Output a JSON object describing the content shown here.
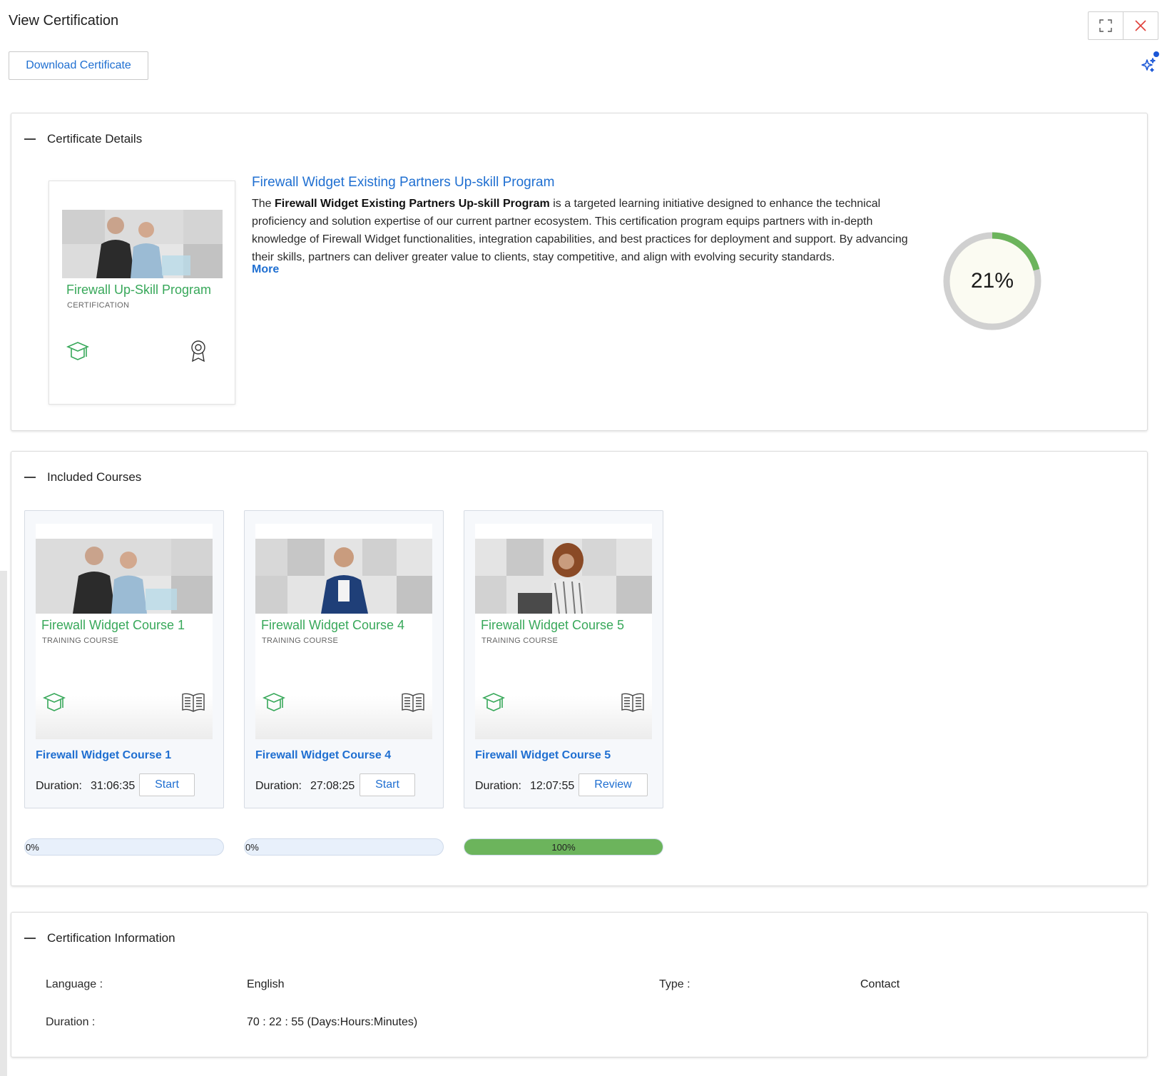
{
  "header": {
    "title": "View Certification"
  },
  "toolbar": {
    "download_label": "Download Certificate"
  },
  "icons": {
    "maximize": "maximize-icon",
    "close": "close-icon",
    "sparkle": "sparkle-icon",
    "mortarboard": "graduation-cap-icon",
    "badge": "award-badge-icon",
    "book": "open-book-icon"
  },
  "colors": {
    "accent_blue": "#1f6fd1",
    "green": "#38a85a",
    "progress_green": "#6cb45c",
    "close_red": "#e0403a"
  },
  "certificate_details": {
    "section_title": "Certificate Details",
    "card": {
      "name": "Firewall Up-Skill Program",
      "type": "CERTIFICATION"
    },
    "title": "Firewall Widget Existing Partners Up-skill Program",
    "desc_prefix": "The ",
    "desc_bold": "Firewall Widget Existing Partners Up-skill Program",
    "desc_rest": " is a targeted learning initiative designed to enhance the technical proficiency and solution expertise of our current partner ecosystem. This certification program equips partners with in-depth knowledge of Firewall Widget functionalities, integration capabilities, and best practices for deployment and support. By advancing their skills, partners can deliver greater value to clients, stay competitive, and align with evolving security standards.",
    "more_label": "More",
    "progress_percent": 21,
    "progress_label": "21%"
  },
  "included_courses": {
    "section_title": "Included Courses",
    "duration_label": "Duration:",
    "courses": [
      {
        "card_name": "Firewall Widget Course 1",
        "card_type": "TRAINING COURSE",
        "link": "Firewall Widget Course 1",
        "duration": "31:06:35",
        "action": "Start",
        "progress": 0,
        "progress_label": "0%"
      },
      {
        "card_name": "Firewall Widget Course 4",
        "card_type": "TRAINING COURSE",
        "link": "Firewall Widget Course 4",
        "duration": "27:08:25",
        "action": "Start",
        "progress": 0,
        "progress_label": "0%"
      },
      {
        "card_name": "Firewall Widget Course 5",
        "card_type": "TRAINING COURSE",
        "link": "Firewall Widget Course 5",
        "duration": "12:07:55",
        "action": "Review",
        "progress": 100,
        "progress_label": "100%"
      }
    ]
  },
  "certification_information": {
    "section_title": "Certification Information",
    "language_label": "Language :",
    "language_value": "English",
    "type_label": "Type :",
    "type_value": "Contact",
    "duration_label": "Duration :",
    "duration_value": "70 : 22 : 55 (Days:Hours:Minutes)"
  }
}
